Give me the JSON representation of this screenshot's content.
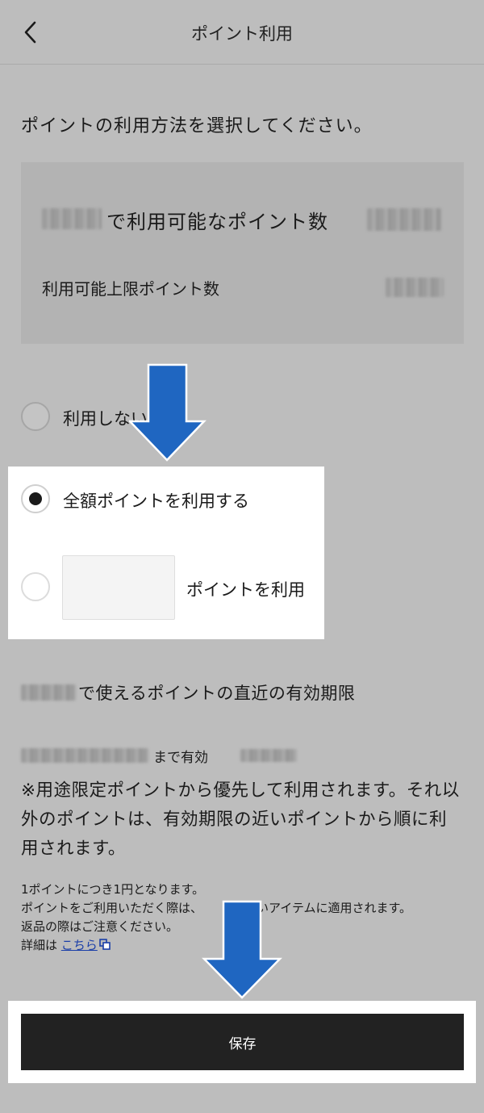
{
  "header": {
    "title": "ポイント利用"
  },
  "instruction": "ポイントの利用方法を選択してください。",
  "info": {
    "available_label": "で利用可能なポイント数",
    "limit_label": "利用可能上限ポイント数"
  },
  "options": {
    "no_use": "利用しない",
    "use_all": "全額ポイントを利用する",
    "use_points_suffix": "ポイントを利用",
    "selected": "use_all"
  },
  "expiry": {
    "heading": "で使えるポイントの直近の有効期限",
    "valid_until_suffix": "まで有効",
    "priority_note": "※用途限定ポイントから優先して利用されます。それ以外のポイントは、有効期限の近いポイントから順に利用されます。"
  },
  "fine_print": {
    "line1": "1ポイントにつき1円となります。",
    "line2_start": "ポイントをご利用いただく際は、",
    "line2_end": "高いアイテムに適用されます。",
    "line3": "返品の際はご注意ください。",
    "details_prefix": "詳細は",
    "details_link": "こちら"
  },
  "save_label": "保存",
  "colors": {
    "arrow": "#1f66c1",
    "button": "#222222",
    "link": "#1a3ea8"
  }
}
